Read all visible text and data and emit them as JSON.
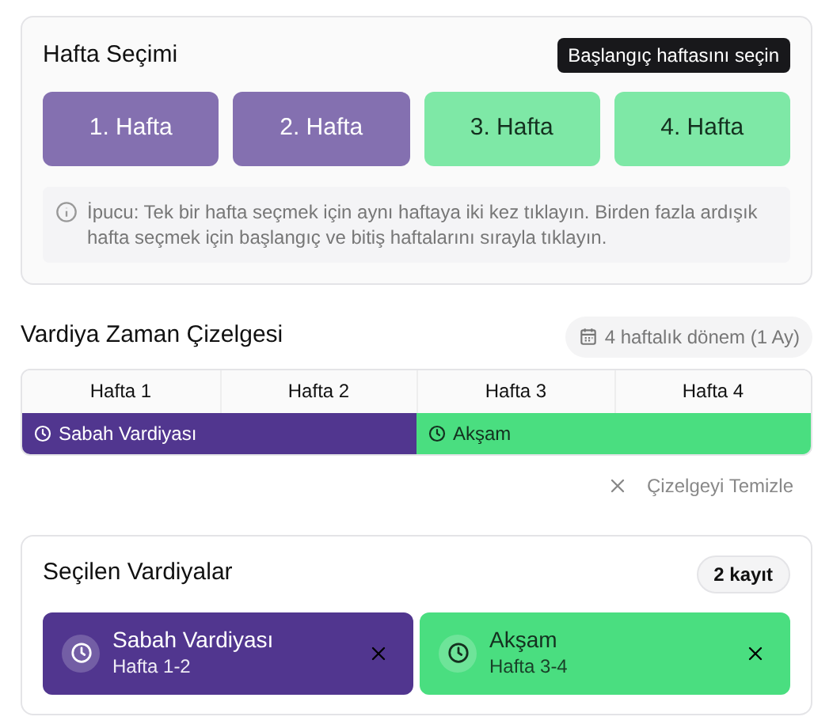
{
  "week_selection": {
    "title": "Hafta Seçimi",
    "hint_badge": "Başlangıç haftasını seçin",
    "weeks": [
      {
        "label": "1. Hafta",
        "kind": "morning",
        "color": "#8470b0"
      },
      {
        "label": "2. Hafta",
        "kind": "morning",
        "color": "#8470b0"
      },
      {
        "label": "3. Hafta",
        "kind": "evening",
        "color": "#7ee8a6"
      },
      {
        "label": "4. Hafta",
        "kind": "evening",
        "color": "#7ee8a6"
      }
    ],
    "tip": "İpucu: Tek bir hafta seçmek için aynı haftaya iki kez tıklayın. Birden fazla ardışık hafta seçmek için başlangıç ve bitiş haftalarını sırayla tıklayın."
  },
  "timeline": {
    "title": "Vardiya Zaman Çizelgesi",
    "period": "4 haftalık dönem (1 Ay)",
    "columns": [
      "Hafta 1",
      "Hafta 2",
      "Hafta 3",
      "Hafta 4"
    ],
    "bars": [
      {
        "label": "Sabah Vardiyası",
        "kind": "morning",
        "color": "#51368f"
      },
      {
        "label": "Akşam",
        "kind": "evening",
        "color": "#4ade80"
      }
    ],
    "clear_button": "Çizelgeyi Temizle"
  },
  "selected_shifts": {
    "title": "Seçilen Vardiyalar",
    "count": "2 kayıt",
    "items": [
      {
        "name": "Sabah Vardiyası",
        "weeks": "Hafta 1-2",
        "kind": "morning",
        "color": "#51368f"
      },
      {
        "name": "Akşam",
        "weeks": "Hafta 3-4",
        "kind": "evening",
        "color": "#4ade80"
      }
    ]
  }
}
